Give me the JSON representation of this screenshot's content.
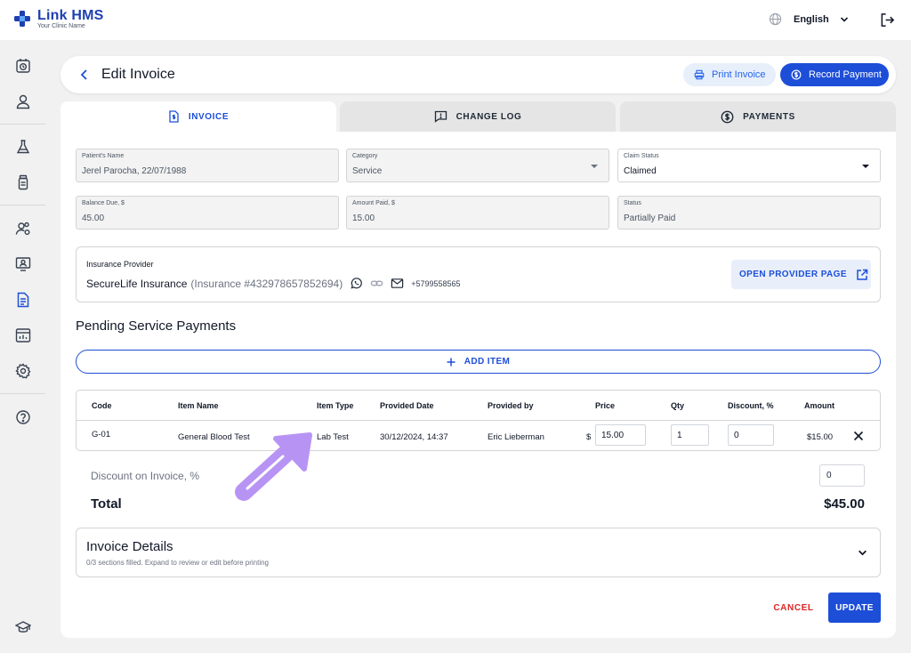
{
  "app": {
    "name": "Link HMS",
    "subtitle": "Your Clinic Name"
  },
  "topbar": {
    "language": "English"
  },
  "header": {
    "title": "Edit Invoice",
    "print_label": "Print Invoice",
    "record_label": "Record Payment"
  },
  "tabs": [
    {
      "label": "INVOICE",
      "active": true
    },
    {
      "label": "CHANGE LOG",
      "active": false
    },
    {
      "label": "PAYMENTS",
      "active": false
    }
  ],
  "form": {
    "patient": {
      "label": "Patient's Name",
      "value": "Jerel Parocha, 22/07/1988"
    },
    "category": {
      "label": "Category",
      "value": "Service"
    },
    "claim_status": {
      "label": "Claim Status",
      "value": "Claimed"
    },
    "balance_due": {
      "label": "Balance Due, $",
      "value": "45.00"
    },
    "amount_paid": {
      "label": "Amount Paid, $",
      "value": "15.00"
    },
    "status": {
      "label": "Status",
      "value": "Partially Paid"
    }
  },
  "insurance": {
    "label": "Insurance Provider",
    "name": "SecureLife Insurance",
    "id_text": "(Insurance #432978657852694)",
    "phone": "+5799558565",
    "open_label": "OPEN PROVIDER PAGE"
  },
  "pending": {
    "title": "Pending Service Payments",
    "add_label": "ADD ITEM",
    "columns": [
      "Code",
      "Item Name",
      "Item Type",
      "Provided Date",
      "Provided by",
      "Price",
      "Qty",
      "Discount, %",
      "Amount"
    ],
    "row": {
      "code": "G-01",
      "item_name": "General Blood Test",
      "item_type": "Lab Test",
      "provided_date": "30/12/2024, 14:37",
      "provided_by": "Eric Lieberman",
      "currency": "$",
      "price": "15.00",
      "qty": "1",
      "discount": "0",
      "amount": "$15.00"
    }
  },
  "summary": {
    "discount_label": "Discount on Invoice, %",
    "discount_value": "0",
    "total_label": "Total",
    "total_value": "$45.00"
  },
  "details": {
    "title": "Invoice Details",
    "subtitle": "0/3 sections filled. Expand to review or edit before printing"
  },
  "actions": {
    "cancel": "CANCEL",
    "update": "UPDATE"
  },
  "colors": {
    "primary": "#1d4ed8",
    "danger": "#dc2626",
    "annotation": "#b794f4"
  }
}
